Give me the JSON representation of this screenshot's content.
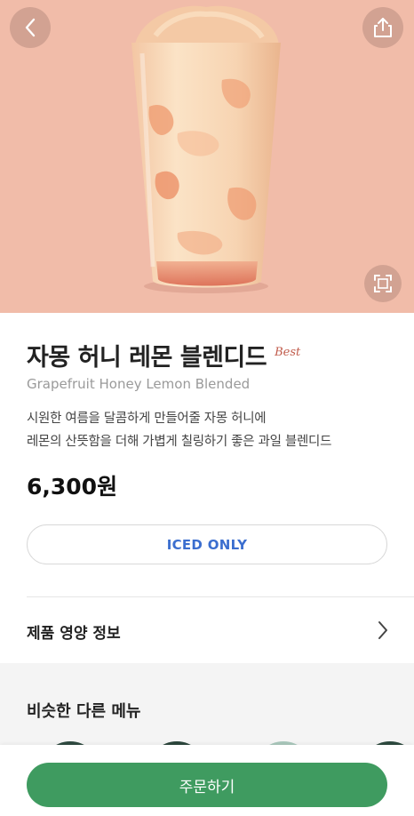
{
  "product": {
    "name_ko": "자몽 허니 레몬 블렌디드",
    "badge": "Best",
    "name_en": "Grapefruit Honey Lemon Blended",
    "description_lines": [
      "시원한 여름을 달콤하게 만들어줄 자몽 허니에",
      "레몬의 산뜻함을 더해 가볍게 칠링하기 좋은 과일 블렌디드"
    ],
    "price": "6,300원",
    "temperature_option": "ICED ONLY"
  },
  "nutrition": {
    "label": "제품 영양 정보"
  },
  "similar_menu": {
    "title": "비슷한 다른 메뉴"
  },
  "order": {
    "button_label": "주문하기"
  },
  "icons": {
    "back": "chevron-left-icon",
    "share": "share-icon",
    "zoom": "expand-icon",
    "nutrition_arrow": "chevron-right-icon"
  },
  "colors": {
    "hero_background": "#f1bca9",
    "order_button": "#3f9b60",
    "iced_text": "#3b6ecf",
    "best_badge": "#c05a4a"
  }
}
